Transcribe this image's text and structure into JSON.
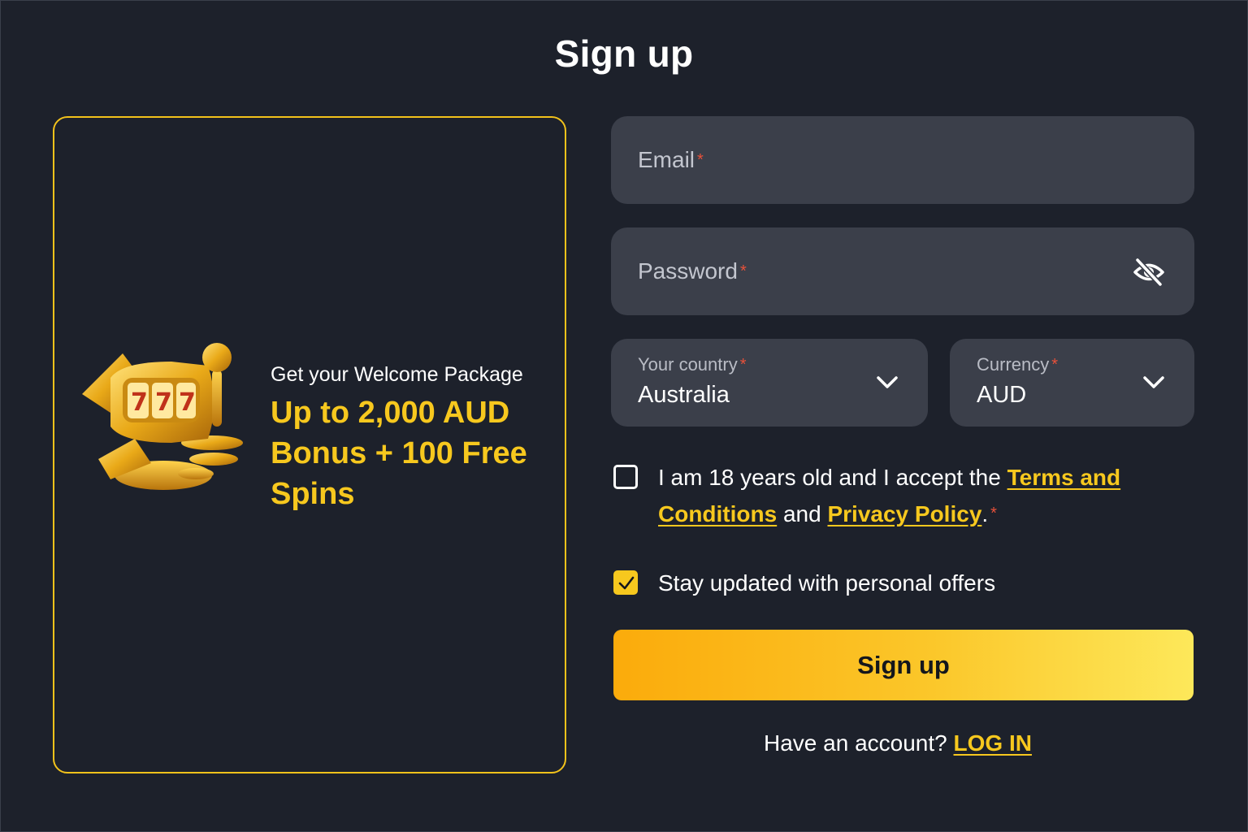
{
  "page": {
    "title": "Sign up"
  },
  "promo": {
    "subtitle": "Get your Welcome Package",
    "offer": "Up to 2,000 AUD Bonus + 100 Free Spins",
    "art_icon": "golden-slot-machine-icon"
  },
  "form": {
    "email": {
      "placeholder": "Email",
      "required_mark": "*"
    },
    "password": {
      "placeholder": "Password",
      "required_mark": "*",
      "toggle_icon": "eye-off-icon"
    },
    "country": {
      "label": "Your country",
      "required_mark": "*",
      "value": "Australia"
    },
    "currency": {
      "label": "Currency",
      "required_mark": "*",
      "value": "AUD"
    },
    "terms": {
      "checked": false,
      "text_before": "I am 18 years old and I accept the ",
      "terms_link": "Terms and Conditions",
      "text_middle": " and ",
      "privacy_link": "Privacy Policy",
      "text_after": ".",
      "required_mark": "*"
    },
    "offers": {
      "checked": true,
      "text": "Stay updated with personal offers"
    },
    "submit_label": "Sign up",
    "login_prompt": "Have an account?",
    "login_link": "LOG IN"
  },
  "colors": {
    "background": "#1d212b",
    "field": "#3b3f4a",
    "accent": "#f7c81e",
    "required": "#e8513a"
  }
}
